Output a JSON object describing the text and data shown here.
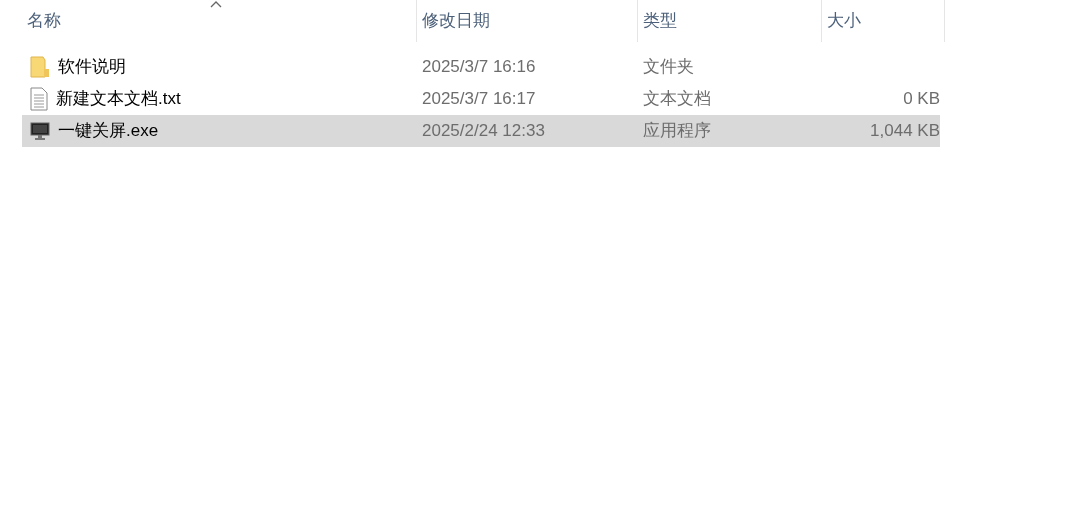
{
  "columns": [
    {
      "label": "名称",
      "sorted": true
    },
    {
      "label": "修改日期",
      "sorted": false
    },
    {
      "label": "类型",
      "sorted": false
    },
    {
      "label": "大小",
      "sorted": false
    }
  ],
  "rows": [
    {
      "kind": "folder",
      "name": "软件说明",
      "modified": "2025/3/7 16:16",
      "type": "文件夹",
      "selected": false
    },
    {
      "kind": "text",
      "name": "新建文本文档.txt",
      "modified": "2025/3/7 16:17",
      "type": "文本文档",
      "size": "0 KB",
      "selected": false
    },
    {
      "kind": "program",
      "name": "一键关屏.exe",
      "modified": "2025/2/24 12:33",
      "type": "应用程序",
      "size": "1,044 KB",
      "selected": true
    }
  ]
}
